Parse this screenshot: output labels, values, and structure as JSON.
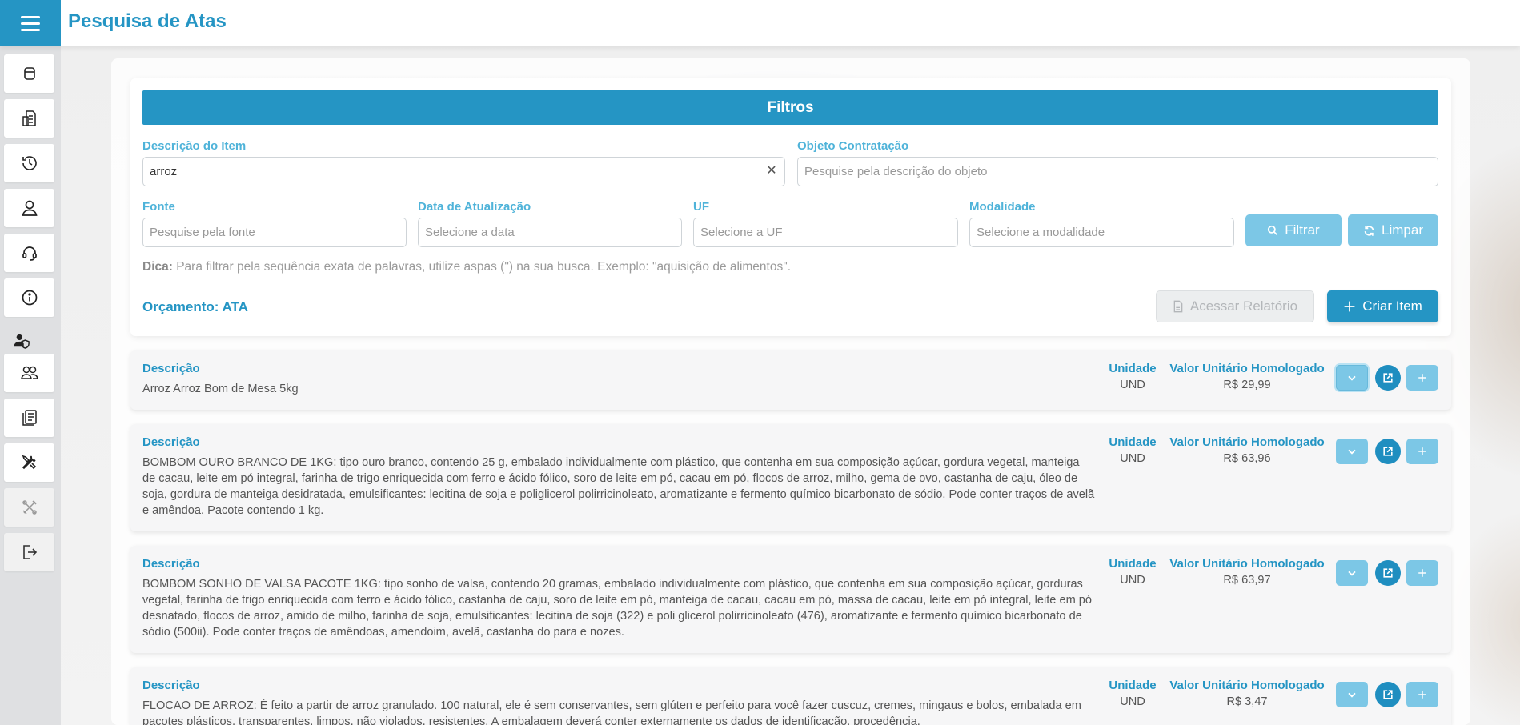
{
  "header": {
    "title": "Pesquisa de Atas"
  },
  "sidebar": {
    "items": [
      {
        "icon": "dashboard-icon"
      },
      {
        "icon": "report-icon"
      },
      {
        "icon": "history-icon"
      },
      {
        "icon": "user-icon"
      },
      {
        "icon": "headset-icon"
      },
      {
        "icon": "info-icon"
      },
      {
        "icon": "users-icon"
      },
      {
        "icon": "documents-icon"
      },
      {
        "icon": "tools-icon"
      },
      {
        "icon": "crossed-tools-icon"
      },
      {
        "icon": "logout-icon"
      }
    ]
  },
  "filters": {
    "title": "Filtros",
    "descricao_item": {
      "label": "Descrição do Item",
      "value": "arroz"
    },
    "objeto": {
      "label": "Objeto Contratação",
      "placeholder": "Pesquise pela descrição do objeto"
    },
    "fonte": {
      "label": "Fonte",
      "placeholder": "Pesquise pela fonte"
    },
    "data": {
      "label": "Data de Atualização",
      "placeholder": "Selecione a data"
    },
    "uf": {
      "label": "UF",
      "placeholder": "Selecione a UF"
    },
    "modalidade": {
      "label": "Modalidade",
      "placeholder": "Selecione a modalidade"
    },
    "filtrar_label": "Filtrar",
    "limpar_label": "Limpar",
    "tip_bold": "Dica:",
    "tip_text": "Para filtrar pela sequência exata de palavras, utilize aspas (\") na sua busca. Exemplo: \"aquisição de alimentos\"."
  },
  "orcamento": {
    "label": "Orçamento: ATA",
    "relatorio_label": "Acessar Relatório",
    "criar_label": "Criar Item"
  },
  "results": {
    "desc_header": "Descrição",
    "unit_header": "Unidade",
    "value_header": "Valor Unitário Homologado",
    "items": [
      {
        "descricao": "Arroz Arroz Bom de Mesa 5kg",
        "unidade": "UND",
        "valor": "R$ 29,99"
      },
      {
        "descricao": "BOMBOM OURO BRANCO DE 1KG: tipo ouro branco, contendo 25 g, embalado individualmente com plástico, que contenha em sua composição açúcar, gordura vegetal, manteiga de cacau, leite em pó integral, farinha de trigo enriquecida com ferro e ácido fólico, soro de leite em pó, cacau em pó, flocos de arroz, milho, gema de ovo, castanha de caju, óleo de soja, gordura de manteiga desidratada, emulsificantes: lecitina de soja e poliglicerol polirricinoleato, aromatizante e fermento químico bicarbonato de sódio. Pode conter traços de avelã e amêndoa. Pacote contendo 1 kg.",
        "unidade": "UND",
        "valor": "R$ 63,96"
      },
      {
        "descricao": "BOMBOM SONHO DE VALSA PACOTE 1KG: tipo sonho de valsa, contendo 20 gramas, embalado individualmente com plástico, que contenha em sua composição açúcar, gorduras vegetal, farinha de trigo enriquecida com ferro e ácido fólico, castanha de caju, soro de leite em pó, manteiga de cacau, cacau em pó, massa de cacau, leite em pó integral, leite em pó desnatado, flocos de arroz, amido de milho, farinha de soja, emulsificantes: lecitina de soja (322) e poli glicerol polirricinoleato (476), aromatizante e fermento químico bicarbonato de sódio (500ii). Pode conter traços de amêndoas, amendoim, avelã, castanha do para e nozes.",
        "unidade": "UND",
        "valor": "R$ 63,97"
      },
      {
        "descricao": "FLOCAO DE ARROZ: É feito a partir de arroz granulado. 100 natural, ele é sem conservantes, sem glúten e perfeito para você fazer cuscuz, cremes, mingaus e bolos, embalada em pacotes plásticos, transparentes, limpos, não violados, resistentes. A embalagem deverá conter externamente os dados de identificação, procedência,",
        "unidade": "UND",
        "valor": "R$ 3,47"
      }
    ]
  }
}
